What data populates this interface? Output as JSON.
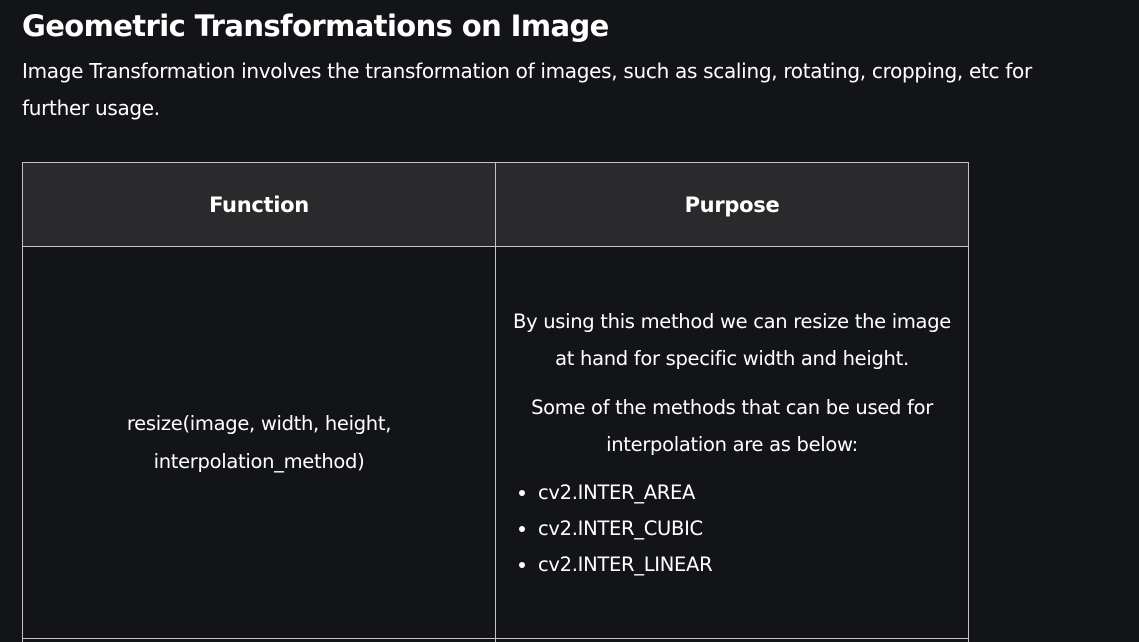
{
  "article": {
    "title": "Geometric Transformations on Image",
    "intro": "Image Transformation involves the transformation of images, such as scaling, rotating, cropping, etc for further usage."
  },
  "table": {
    "headers": [
      "Function",
      "Purpose"
    ],
    "rows": [
      {
        "function": "resize(image, width, height, interpolation_method)",
        "purpose_paragraphs": [
          "By using this method we can resize the image at hand for specific width and height.",
          "Some of the methods that can be used for interpolation are as below:"
        ],
        "purpose_list": [
          "cv2.INTER_AREA",
          "cv2.INTER_CUBIC",
          "cv2.INTER_LINEAR"
        ]
      }
    ]
  }
}
